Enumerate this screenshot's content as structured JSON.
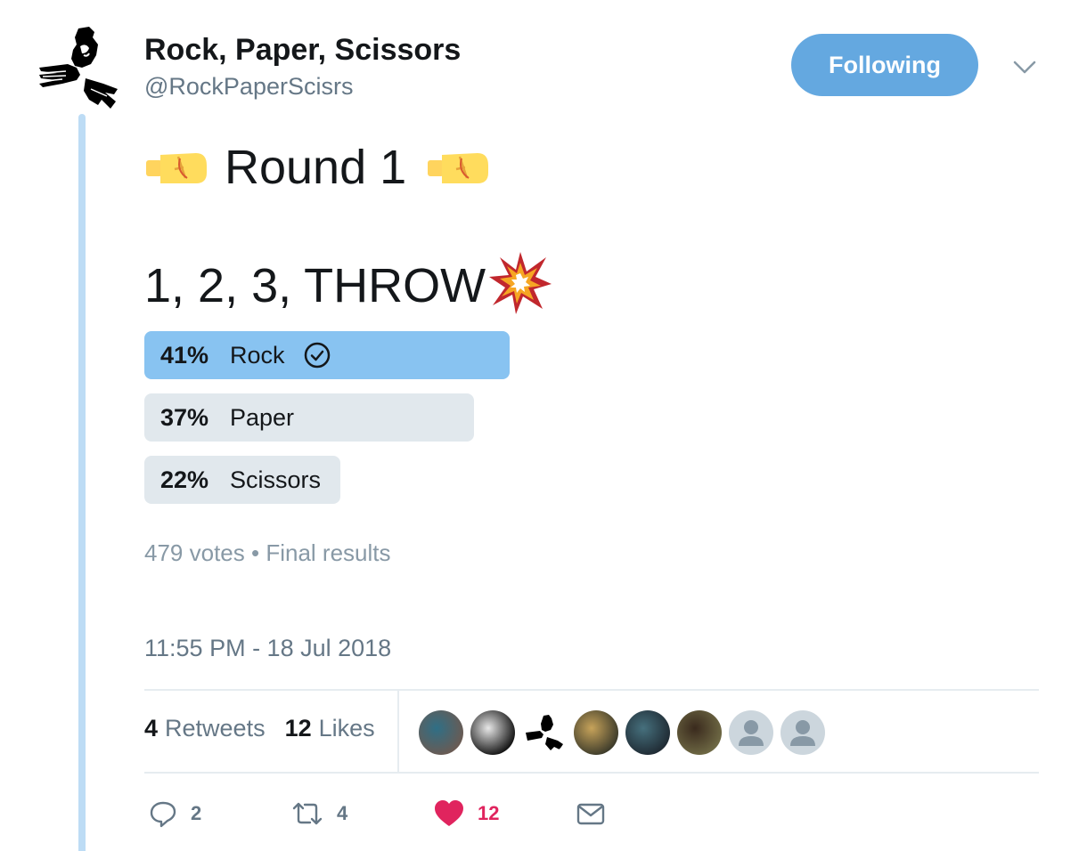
{
  "author": {
    "display_name": "Rock, Paper, Scissors",
    "handle": "@RockPaperScisrs",
    "avatar_icon": "rock-paper-scissors-hands-logo"
  },
  "follow_button": {
    "label": "Following",
    "color": "#64a8e0"
  },
  "tweet": {
    "round_text": "Round 1",
    "throw_text": "1, 2, 3, THROW",
    "emoji": {
      "left": "fist-bump-emoji",
      "right": "fist-bump-emoji",
      "throw": "collision-emoji"
    }
  },
  "poll": {
    "options": [
      {
        "percent_label": "41%",
        "label": "Rock",
        "share": 0.41,
        "winner": true
      },
      {
        "percent_label": "37%",
        "label": "Paper",
        "share": 0.37,
        "winner": false
      },
      {
        "percent_label": "22%",
        "label": "Scissors",
        "share": 0.22,
        "winner": false
      }
    ],
    "votes": "479 votes",
    "separator": "•",
    "status": "Final results",
    "winner_color": "#88c3f1",
    "other_color": "#e1e8ed"
  },
  "timestamp": "11:55 PM - 18 Jul 2018",
  "stats": {
    "retweets": {
      "count": "4",
      "label": "Retweets"
    },
    "likes": {
      "count": "12",
      "label": "Likes"
    }
  },
  "likers": [
    {
      "name": "liker-avatar-1",
      "colors": [
        "#6b5a52",
        "#2f6f86"
      ]
    },
    {
      "name": "liker-avatar-2",
      "colors": [
        "#111111",
        "#e8e8e8"
      ]
    },
    {
      "name": "liker-avatar-3",
      "colors": [
        "#ffffff",
        "#000000"
      ]
    },
    {
      "name": "liker-avatar-4",
      "colors": [
        "#3b3a2a",
        "#c7a35a"
      ]
    },
    {
      "name": "liker-avatar-5",
      "colors": [
        "#1f2a33",
        "#46707d"
      ]
    },
    {
      "name": "liker-avatar-6",
      "colors": [
        "#6f6a45",
        "#3a2a1d"
      ]
    },
    {
      "name": "liker-avatar-7",
      "colors": [
        "#ccd6dd",
        "#8899a6"
      ]
    },
    {
      "name": "liker-avatar-8",
      "colors": [
        "#ccd6dd",
        "#8899a6"
      ]
    }
  ],
  "actions": {
    "reply": {
      "icon": "reply-icon",
      "count": "2"
    },
    "retweet": {
      "icon": "retweet-icon",
      "count": "4"
    },
    "like": {
      "icon": "heart-icon",
      "count": "12",
      "color": "#e0245e"
    },
    "dm": {
      "icon": "envelope-icon"
    }
  },
  "colors": {
    "thread_line": "#bddcf5",
    "secondary_text": "#657786"
  }
}
